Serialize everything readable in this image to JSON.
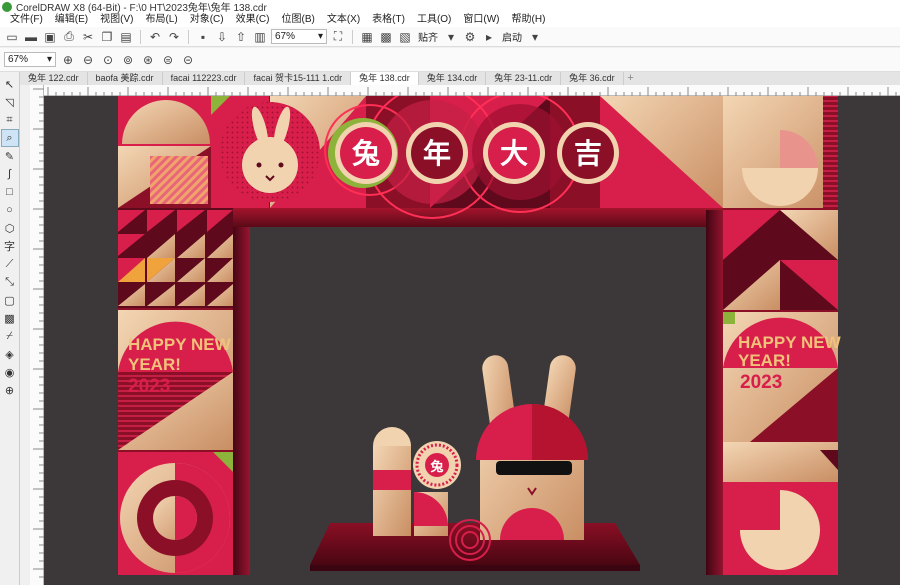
{
  "window": {
    "title": "CorelDRAW X8 (64-Bit) - F:\\0 HT\\2023兔年\\兔年 138.cdr"
  },
  "menu": [
    "文件(F)",
    "编辑(E)",
    "视图(V)",
    "布局(L)",
    "对象(C)",
    "效果(C)",
    "位图(B)",
    "文本(X)",
    "表格(T)",
    "工具(O)",
    "窗口(W)",
    "帮助(H)"
  ],
  "toolbar": {
    "zoom": "67%",
    "snap_label": "贴齐",
    "launch_label": "启动"
  },
  "propbar": {
    "zoom": "67%"
  },
  "tabs": [
    "兔年 122.cdr",
    "baofa 美踪.cdr",
    "facai 112223.cdr",
    "facai 贺卡15-111 1.cdr",
    "兔年 138.cdr",
    "兔年 134.cdr",
    "兔年 23-11.cdr",
    "兔年 36.cdr"
  ],
  "active_tab": 4,
  "artwork": {
    "banner_chars": [
      "兔",
      "年",
      "大",
      "吉"
    ],
    "left_greeting": [
      "HAPPY NEW",
      "YEAR!",
      "2023"
    ],
    "right_greeting": [
      "HAPPY NEW",
      "YEAR!",
      "2023"
    ],
    "lantern_char": "兔",
    "colors": {
      "crimson": "#d81e4a",
      "dark_red": "#8c0f28",
      "maroon": "#5e0a1c",
      "gold": "#e4b58c",
      "cream": "#f2d3b0",
      "lime": "#8db33a",
      "canvas": "#3c3839"
    }
  }
}
